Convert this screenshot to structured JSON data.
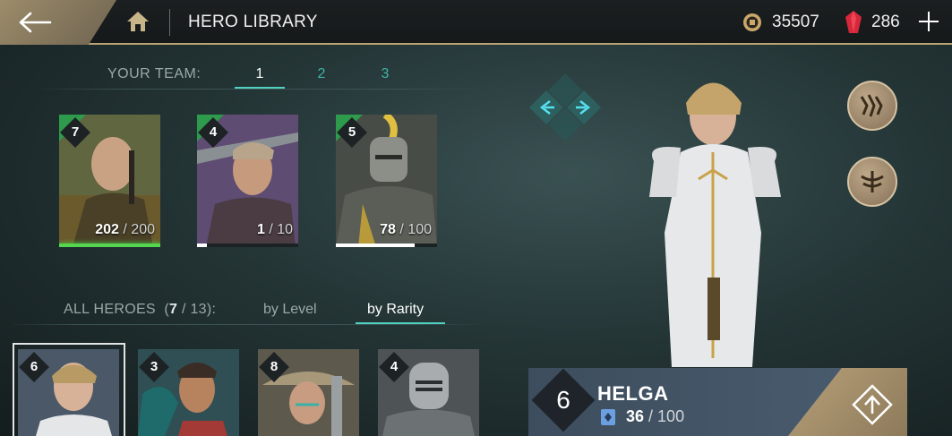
{
  "header": {
    "title": "HERO LIBRARY",
    "coins": "35507",
    "gems": "286"
  },
  "team": {
    "label": "YOUR TEAM:",
    "tabs": [
      {
        "label": "1",
        "active": true
      },
      {
        "label": "2",
        "active": false
      },
      {
        "label": "3",
        "active": false
      }
    ],
    "cards": [
      {
        "level": "7",
        "current": "202",
        "max": "/ 200",
        "progress": 1.0,
        "bg": "#4f5a3a"
      },
      {
        "level": "4",
        "current": "1",
        "max": "/ 10",
        "progress": 0.1,
        "bg": "#5a4a66"
      },
      {
        "level": "5",
        "current": "78",
        "max": "/ 100",
        "progress": 0.78,
        "bg": "#4a4f4a"
      }
    ]
  },
  "roster": {
    "label": "ALL HEROES",
    "count_open": "(",
    "count_owned": "7",
    "count_total": "/ 13):",
    "sort_tabs": [
      {
        "label": "by Level",
        "active": false
      },
      {
        "label": "by Rarity",
        "active": true
      }
    ],
    "cards": [
      {
        "level": "6",
        "bg": "#4a5868"
      },
      {
        "level": "3",
        "bg": "#2f4f54"
      },
      {
        "level": "8",
        "bg": "#5d5a4d"
      },
      {
        "level": "4",
        "bg": "#4e5356"
      }
    ]
  },
  "selected_hero": {
    "name": "HELGA",
    "level": "6",
    "current": "36",
    "max": "/ 100"
  },
  "colors": {
    "accent": "#4fd0c0",
    "gold": "#b9a274",
    "progress_full": "#54d64e"
  }
}
